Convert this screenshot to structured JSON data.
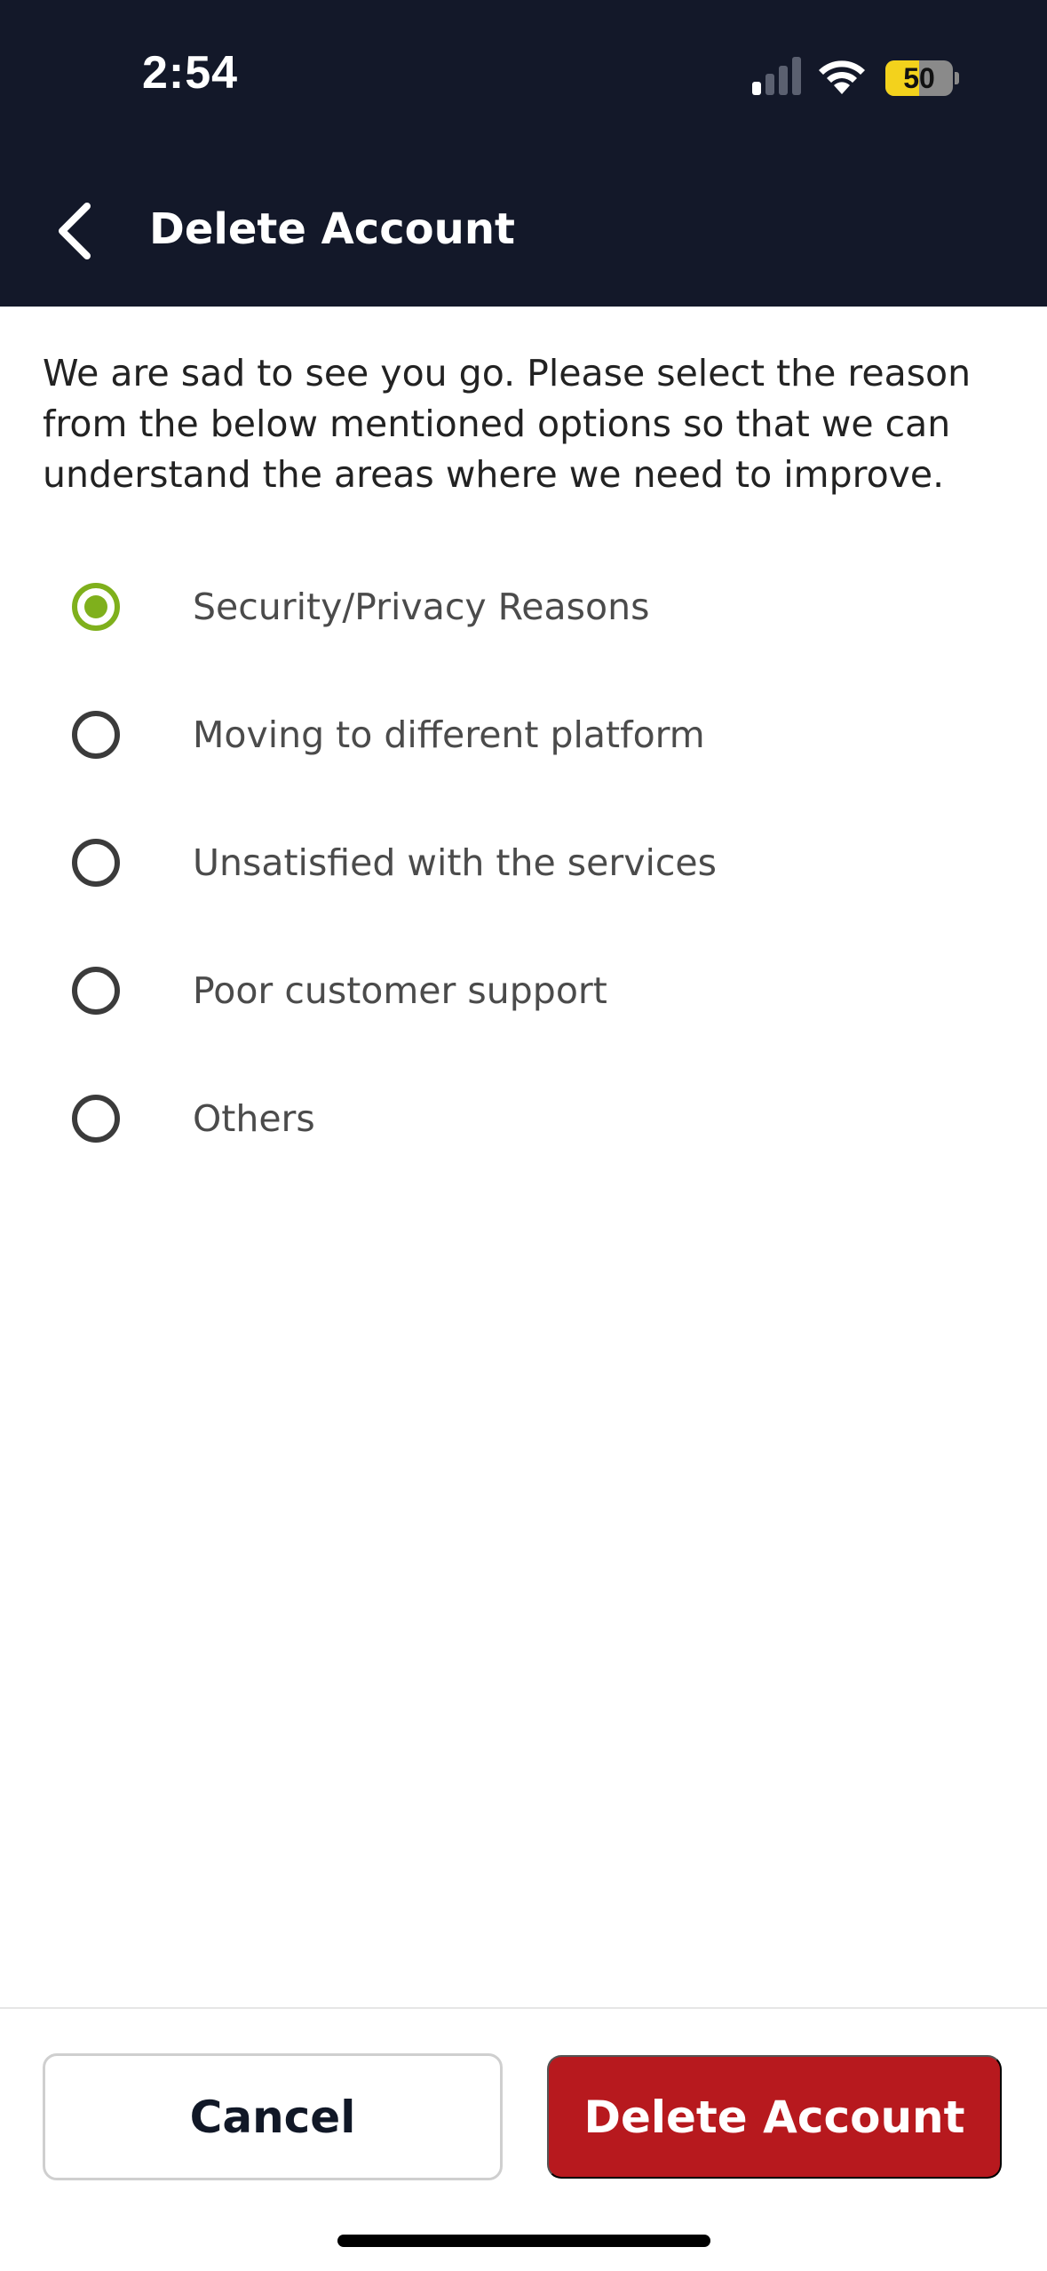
{
  "status_bar": {
    "time": "2:54",
    "battery_percent": "50",
    "battery_level": 0.5,
    "signal_bars_active": 1,
    "icons": [
      "cellular-signal-icon",
      "wifi-icon",
      "battery-charging-icon"
    ]
  },
  "header": {
    "title": "Delete Account",
    "back_icon": "chevron-left-icon",
    "background_color": "#131829"
  },
  "intro_text": "We are sad to see you go. Please select the reason from the below mentioned options so that we can understand the areas where we need to improve.",
  "reasons": [
    {
      "label": "Security/Privacy Reasons",
      "selected": true
    },
    {
      "label": "Moving to different platform",
      "selected": false
    },
    {
      "label": "Unsatisfied with the services",
      "selected": false
    },
    {
      "label": "Poor customer support",
      "selected": false
    },
    {
      "label": "Others",
      "selected": false
    }
  ],
  "footer": {
    "cancel_label": "Cancel",
    "delete_label": "Delete Account"
  },
  "colors": {
    "accent_selected": "#7fb01c",
    "danger": "#b7191e",
    "battery_yellow": "#f3d21c"
  }
}
